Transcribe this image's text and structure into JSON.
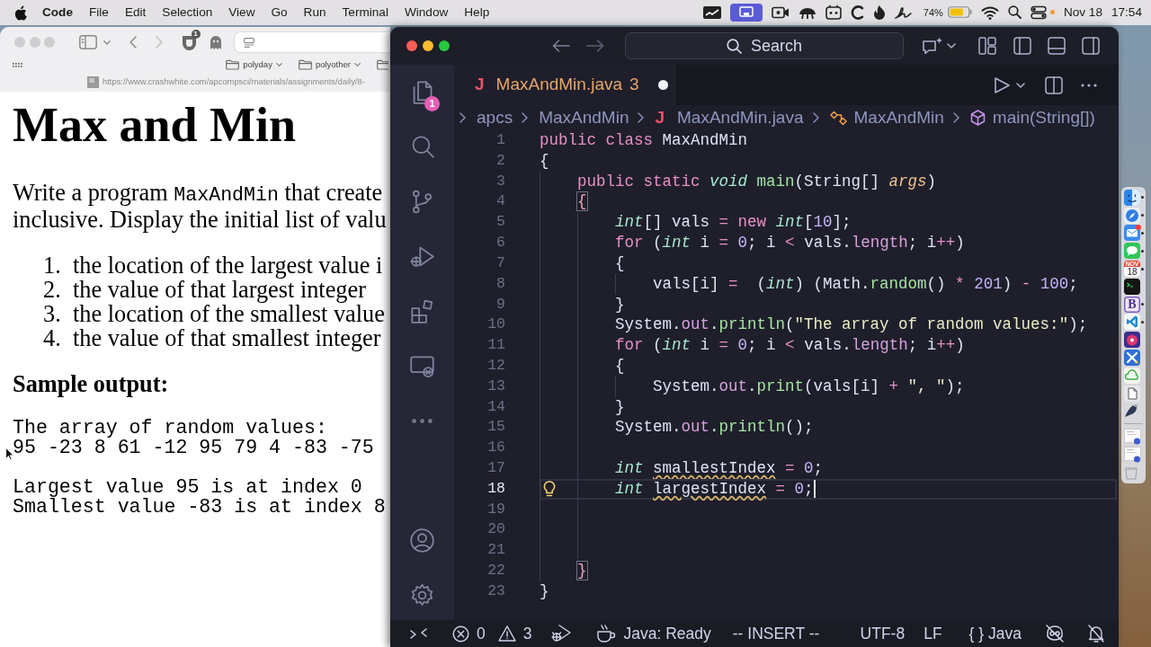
{
  "menu_bar": {
    "app_name": "Code",
    "menus": [
      "File",
      "Edit",
      "Selection",
      "View",
      "Go",
      "Run",
      "Terminal",
      "Window",
      "Help"
    ],
    "battery_percent": "74%",
    "date": "Nov 18",
    "time": "17:54"
  },
  "browser": {
    "active": false,
    "extension_badge": "1",
    "bookmarks": [
      {
        "label": "polyday"
      },
      {
        "label": "polyother"
      }
    ],
    "url": "https://www.crashwhite.com/apcompsci/materials/assignments/daily/8-",
    "page": {
      "title": "Max and Min",
      "intro_lines": [
        [
          {
            "text": "Write a program ",
            "kind": "prose"
          },
          {
            "text": "MaxAndMin",
            "kind": "code"
          },
          {
            "text": " that create",
            "kind": "prose"
          }
        ],
        [
          {
            "text": "inclusive. Display the initial list of valu",
            "kind": "prose"
          }
        ]
      ],
      "steps": [
        {
          "number": "1.",
          "text": "the location of the largest value i"
        },
        {
          "number": "2.",
          "text": "the value of that largest integer"
        },
        {
          "number": "3.",
          "text": "the location of the smallest value"
        },
        {
          "number": "4.",
          "text": "the value of that smallest integer"
        }
      ],
      "sample_heading": "Sample output:",
      "sample_output": [
        [
          "The array of random values:",
          "95 -23 8 61 -12 95 79 4 -83 -75"
        ],
        [
          "Largest value 95 is at index 0",
          "Smallest value -83 is at index 8"
        ]
      ]
    }
  },
  "editor_window": {
    "active": true,
    "command_center": {
      "label": "Search"
    },
    "activity_bar": {
      "top": [
        {
          "kind": "explorer",
          "badge": "1"
        },
        {
          "kind": "search"
        },
        {
          "kind": "scm"
        },
        {
          "kind": "debug"
        },
        {
          "kind": "extensions"
        },
        {
          "kind": "remote"
        },
        {
          "kind": "more"
        }
      ],
      "bottom": [
        {
          "kind": "account"
        },
        {
          "kind": "settings"
        }
      ]
    },
    "tabs": [
      {
        "file_glyph": "J",
        "label": "MaxAndMin.java",
        "problems": "3",
        "modified": true,
        "selected": true
      }
    ],
    "breadcrumbs": [
      {
        "kind": "folder",
        "label": "apcs"
      },
      {
        "kind": "folder",
        "label": "MaxAndMin"
      },
      {
        "kind": "file",
        "glyph": "J",
        "label": "MaxAndMin.java"
      },
      {
        "kind": "class",
        "label": "MaxAndMin"
      },
      {
        "kind": "method",
        "label": "main(String[])"
      }
    ],
    "code_lines": [
      {
        "number": "1",
        "current": false,
        "lightbulb": false,
        "tokens": [
          {
            "text": "public ",
            "kind": "keyword"
          },
          {
            "text": "class ",
            "kind": "keyword"
          },
          {
            "text": "MaxAndMin",
            "kind": "plain"
          }
        ]
      },
      {
        "number": "2",
        "current": false,
        "lightbulb": false,
        "tokens": [
          {
            "text": "{",
            "kind": "plain"
          }
        ],
        "children": [
          {
            "number": "3",
            "current": false,
            "lightbulb": false,
            "tokens": [
              {
                "text": "public ",
                "kind": "keyword"
              },
              {
                "text": "static ",
                "kind": "keyword"
              },
              {
                "text": "void ",
                "kind": "type"
              },
              {
                "text": "main",
                "kind": "function"
              },
              {
                "text": "(String[] ",
                "kind": "plain"
              },
              {
                "text": "args",
                "kind": "param"
              },
              {
                "text": ")",
                "kind": "plain"
              }
            ]
          },
          {
            "number": "4",
            "current": false,
            "lightbulb": false,
            "tokens": [
              {
                "text": "{",
                "kind": "bracket"
              }
            ],
            "children": [
              {
                "number": "5",
                "current": false,
                "lightbulb": false,
                "tokens": [
                  {
                    "text": "int",
                    "kind": "type"
                  },
                  {
                    "text": "[] vals ",
                    "kind": "plain"
                  },
                  {
                    "text": "= ",
                    "kind": "operator"
                  },
                  {
                    "text": "new ",
                    "kind": "keyword"
                  },
                  {
                    "text": "int",
                    "kind": "type"
                  },
                  {
                    "text": "[",
                    "kind": "plain"
                  },
                  {
                    "text": "10",
                    "kind": "number"
                  },
                  {
                    "text": "];",
                    "kind": "plain"
                  }
                ]
              },
              {
                "number": "6",
                "current": false,
                "lightbulb": false,
                "tokens": [
                  {
                    "text": "for ",
                    "kind": "keyword"
                  },
                  {
                    "text": "(",
                    "kind": "plain"
                  },
                  {
                    "text": "int",
                    "kind": "type"
                  },
                  {
                    "text": " i ",
                    "kind": "plain"
                  },
                  {
                    "text": "= ",
                    "kind": "operator"
                  },
                  {
                    "text": "0",
                    "kind": "number"
                  },
                  {
                    "text": "; i ",
                    "kind": "plain"
                  },
                  {
                    "text": "< ",
                    "kind": "operator"
                  },
                  {
                    "text": "vals.",
                    "kind": "plain"
                  },
                  {
                    "text": "length",
                    "kind": "field"
                  },
                  {
                    "text": "; i",
                    "kind": "plain"
                  },
                  {
                    "text": "++",
                    "kind": "operator"
                  },
                  {
                    "text": ")",
                    "kind": "plain"
                  }
                ]
              },
              {
                "number": "7",
                "current": false,
                "lightbulb": false,
                "tokens": [
                  {
                    "text": "{",
                    "kind": "plain"
                  }
                ],
                "children": [
                  {
                    "number": "8",
                    "current": false,
                    "lightbulb": false,
                    "tokens": [
                      {
                        "text": "vals[i] ",
                        "kind": "plain"
                      },
                      {
                        "text": "=  ",
                        "kind": "operator"
                      },
                      {
                        "text": "(",
                        "kind": "plain"
                      },
                      {
                        "text": "int",
                        "kind": "type"
                      },
                      {
                        "text": ") (Math.",
                        "kind": "plain"
                      },
                      {
                        "text": "random",
                        "kind": "function"
                      },
                      {
                        "text": "() ",
                        "kind": "plain"
                      },
                      {
                        "text": "* ",
                        "kind": "operator"
                      },
                      {
                        "text": "201",
                        "kind": "number"
                      },
                      {
                        "text": ") ",
                        "kind": "plain"
                      },
                      {
                        "text": "- ",
                        "kind": "operator"
                      },
                      {
                        "text": "100",
                        "kind": "number"
                      },
                      {
                        "text": ";",
                        "kind": "plain"
                      }
                    ]
                  }
                ]
              },
              {
                "number": "9",
                "current": false,
                "lightbulb": false,
                "tokens": [
                  {
                    "text": "}",
                    "kind": "plain"
                  }
                ]
              },
              {
                "number": "10",
                "current": false,
                "lightbulb": false,
                "tokens": [
                  {
                    "text": "System.",
                    "kind": "plain"
                  },
                  {
                    "text": "out",
                    "kind": "field"
                  },
                  {
                    "text": ".",
                    "kind": "plain"
                  },
                  {
                    "text": "println",
                    "kind": "function"
                  },
                  {
                    "text": "(",
                    "kind": "plain"
                  },
                  {
                    "text": "\"The array of random values:\"",
                    "kind": "string"
                  },
                  {
                    "text": ");",
                    "kind": "plain"
                  }
                ]
              },
              {
                "number": "11",
                "current": false,
                "lightbulb": false,
                "tokens": [
                  {
                    "text": "for ",
                    "kind": "keyword"
                  },
                  {
                    "text": "(",
                    "kind": "plain"
                  },
                  {
                    "text": "int",
                    "kind": "type"
                  },
                  {
                    "text": " i ",
                    "kind": "plain"
                  },
                  {
                    "text": "= ",
                    "kind": "operator"
                  },
                  {
                    "text": "0",
                    "kind": "number"
                  },
                  {
                    "text": "; i ",
                    "kind": "plain"
                  },
                  {
                    "text": "< ",
                    "kind": "operator"
                  },
                  {
                    "text": "vals.",
                    "kind": "plain"
                  },
                  {
                    "text": "length",
                    "kind": "field"
                  },
                  {
                    "text": "; i",
                    "kind": "plain"
                  },
                  {
                    "text": "++",
                    "kind": "operator"
                  },
                  {
                    "text": ")",
                    "kind": "plain"
                  }
                ]
              },
              {
                "number": "12",
                "current": false,
                "lightbulb": false,
                "tokens": [
                  {
                    "text": "{",
                    "kind": "plain"
                  }
                ],
                "children": [
                  {
                    "number": "13",
                    "current": false,
                    "lightbulb": false,
                    "tokens": [
                      {
                        "text": "System.",
                        "kind": "plain"
                      },
                      {
                        "text": "out",
                        "kind": "field"
                      },
                      {
                        "text": ".",
                        "kind": "plain"
                      },
                      {
                        "text": "print",
                        "kind": "function"
                      },
                      {
                        "text": "(vals[i] ",
                        "kind": "plain"
                      },
                      {
                        "text": "+ ",
                        "kind": "operator"
                      },
                      {
                        "text": "\", \"",
                        "kind": "string"
                      },
                      {
                        "text": ");",
                        "kind": "plain"
                      }
                    ]
                  }
                ]
              },
              {
                "number": "14",
                "current": false,
                "lightbulb": false,
                "tokens": [
                  {
                    "text": "}",
                    "kind": "plain"
                  }
                ]
              },
              {
                "number": "15",
                "current": false,
                "lightbulb": false,
                "tokens": [
                  {
                    "text": "System.",
                    "kind": "plain"
                  },
                  {
                    "text": "out",
                    "kind": "field"
                  },
                  {
                    "text": ".",
                    "kind": "plain"
                  },
                  {
                    "text": "println",
                    "kind": "function"
                  },
                  {
                    "text": "();",
                    "kind": "plain"
                  }
                ]
              },
              {
                "number": "16",
                "current": false,
                "lightbulb": false
              },
              {
                "number": "17",
                "current": false,
                "lightbulb": false,
                "tokens": [
                  {
                    "text": "int ",
                    "kind": "type"
                  },
                  {
                    "text": "smallestIndex",
                    "kind": "unused"
                  },
                  {
                    "text": " = ",
                    "kind": "operator"
                  },
                  {
                    "text": "0",
                    "kind": "number"
                  },
                  {
                    "text": ";",
                    "kind": "plain"
                  }
                ]
              },
              {
                "number": "18",
                "current": true,
                "lightbulb": true,
                "tokens": [
                  {
                    "text": "int ",
                    "kind": "type"
                  },
                  {
                    "text": "largestIndex",
                    "kind": "unused"
                  },
                  {
                    "text": " = ",
                    "kind": "operator"
                  },
                  {
                    "text": "0",
                    "kind": "number"
                  },
                  {
                    "text": ";",
                    "kind": "plain"
                  }
                ]
              },
              {
                "number": "19",
                "current": false,
                "lightbulb": false
              },
              {
                "number": "20",
                "current": false,
                "lightbulb": false
              },
              {
                "number": "21",
                "current": false,
                "lightbulb": false
              }
            ]
          },
          {
            "number": "22",
            "current": false,
            "lightbulb": false,
            "tokens": [
              {
                "text": "}",
                "kind": "bracket"
              }
            ]
          }
        ]
      },
      {
        "number": "23",
        "current": false,
        "lightbulb": false,
        "tokens": [
          {
            "text": "}",
            "kind": "plain"
          }
        ]
      }
    ],
    "status_bar": {
      "left": [
        {
          "kind": "remote"
        },
        {
          "kind": "problems",
          "errors": "0",
          "warnings": "3"
        },
        {
          "kind": "debug"
        },
        {
          "kind": "java",
          "label": "Java: Ready"
        },
        {
          "kind": "text",
          "label": "-- INSERT --"
        }
      ],
      "right": [
        {
          "kind": "text",
          "label": "UTF-8"
        },
        {
          "kind": "text",
          "label": "LF"
        },
        {
          "kind": "text",
          "label": "{ } Java"
        },
        {
          "kind": "copilot"
        },
        {
          "kind": "bell"
        }
      ]
    }
  },
  "dock": {
    "apps": [
      {
        "kind": "face",
        "running": true,
        "badge": false
      },
      {
        "kind": "compass",
        "running": true,
        "badge": false
      },
      {
        "kind": "envelope",
        "running": true,
        "badge": true
      },
      {
        "kind": "bubble",
        "running": true,
        "badge": false
      },
      {
        "kind": "calendar",
        "running": true,
        "badge": false,
        "month": "NOV",
        "day": "18"
      },
      {
        "kind": "terminal",
        "running": false,
        "badge": false
      },
      {
        "kind": "letter",
        "running": true,
        "badge": false,
        "glyph": "B"
      },
      {
        "kind": "code",
        "running": true,
        "badge": false
      },
      {
        "kind": "disc",
        "running": false,
        "badge": false
      },
      {
        "kind": "tools",
        "running": false,
        "badge": false
      },
      {
        "kind": "cloud",
        "running": false,
        "badge": false
      },
      {
        "kind": "page",
        "running": false,
        "badge": false
      },
      {
        "kind": "bird",
        "running": false,
        "badge": false
      }
    ],
    "others": [
      {
        "kind": "thumbnail"
      },
      {
        "kind": "thumbnail"
      },
      {
        "kind": "trash"
      }
    ]
  }
}
